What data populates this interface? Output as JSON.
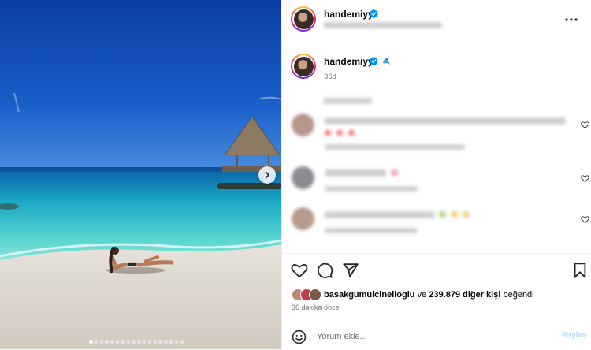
{
  "media": {
    "dot_count": 18,
    "active_dot": 0,
    "next_icon": "chevron-right-icon"
  },
  "header": {
    "username": "handemiyy",
    "verified_icon": "verified-badge-icon",
    "more_icon": "more-horizontal-icon"
  },
  "caption": {
    "username": "handemiyy",
    "emoji_icon": "dolphin-emoji-icon",
    "time": "36d"
  },
  "actions": {
    "like_icon": "heart-icon",
    "comment_icon": "comment-icon",
    "share_icon": "send-icon",
    "save_icon": "bookmark-icon"
  },
  "likes": {
    "liked_by": "basakgumulcinelioglu",
    "connector": "ve",
    "others": "239.879 diğer kişi",
    "suffix": "beğendi"
  },
  "time_ago": "36 dakika önce",
  "comment_box": {
    "placeholder": "Yorum ekle...",
    "share_label": "Paylaş"
  },
  "colors": {
    "accent_blue": "#0095f6",
    "verified_blue": "#0095f6",
    "share_disabled": "#b3dbff"
  }
}
